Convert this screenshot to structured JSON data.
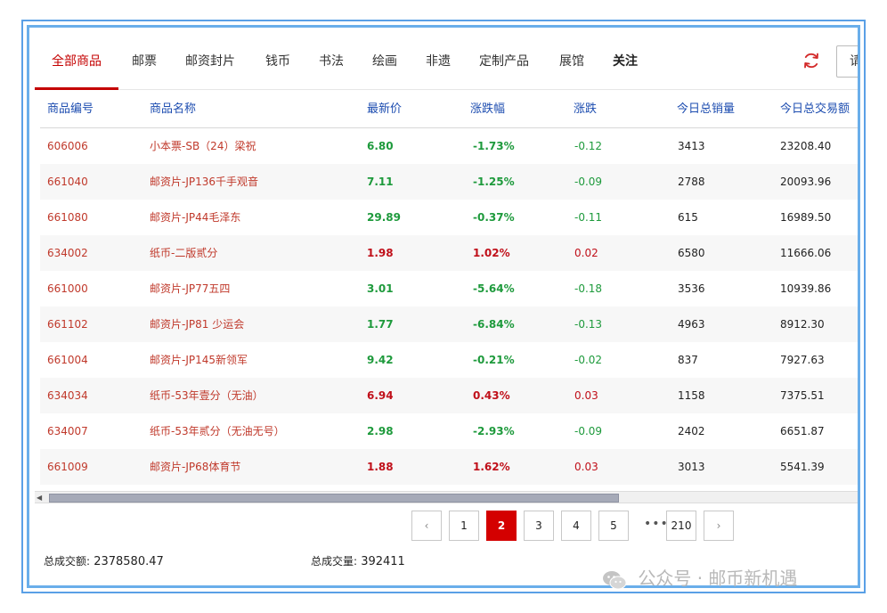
{
  "tabs": [
    {
      "label": "全部商品",
      "active": true
    },
    {
      "label": "邮票"
    },
    {
      "label": "邮资封片"
    },
    {
      "label": "钱币"
    },
    {
      "label": "书法"
    },
    {
      "label": "绘画"
    },
    {
      "label": "非遗"
    },
    {
      "label": "定制产品"
    },
    {
      "label": "展馆"
    },
    {
      "label": "关注"
    }
  ],
  "search": {
    "placeholder": "请"
  },
  "table": {
    "headers": [
      "商品编号",
      "商品名称",
      "最新价",
      "涨跌幅",
      "涨跌",
      "今日总销量",
      "今日总交易额"
    ],
    "rows": [
      {
        "code": "606006",
        "name": "小本票-SB（24）梁祝",
        "price": "6.80",
        "pct": "-1.73%",
        "chg": "-0.12",
        "vol": "3413",
        "amt": "23208.40",
        "trend": "down"
      },
      {
        "code": "661040",
        "name": "邮资片-JP136千手观音",
        "price": "7.11",
        "pct": "-1.25%",
        "chg": "-0.09",
        "vol": "2788",
        "amt": "20093.96",
        "trend": "down"
      },
      {
        "code": "661080",
        "name": "邮资片-JP44毛泽东",
        "price": "29.89",
        "pct": "-0.37%",
        "chg": "-0.11",
        "vol": "615",
        "amt": "16989.50",
        "trend": "down"
      },
      {
        "code": "634002",
        "name": "纸币-二版贰分",
        "price": "1.98",
        "pct": "1.02%",
        "chg": "0.02",
        "vol": "6580",
        "amt": "11666.06",
        "trend": "up"
      },
      {
        "code": "661000",
        "name": "邮资片-JP77五四",
        "price": "3.01",
        "pct": "-5.64%",
        "chg": "-0.18",
        "vol": "3536",
        "amt": "10939.86",
        "trend": "down"
      },
      {
        "code": "661102",
        "name": "邮资片-JP81 少运会",
        "price": "1.77",
        "pct": "-6.84%",
        "chg": "-0.13",
        "vol": "4963",
        "amt": "8912.30",
        "trend": "down"
      },
      {
        "code": "661004",
        "name": "邮资片-JP145新领军",
        "price": "9.42",
        "pct": "-0.21%",
        "chg": "-0.02",
        "vol": "837",
        "amt": "7927.63",
        "trend": "down"
      },
      {
        "code": "634034",
        "name": "纸币-53年壹分（无油）",
        "price": "6.94",
        "pct": "0.43%",
        "chg": "0.03",
        "vol": "1158",
        "amt": "7375.51",
        "trend": "up"
      },
      {
        "code": "634007",
        "name": "纸币-53年贰分（无油无号）",
        "price": "2.98",
        "pct": "-2.93%",
        "chg": "-0.09",
        "vol": "2402",
        "amt": "6651.87",
        "trend": "down"
      },
      {
        "code": "661009",
        "name": "邮资片-JP68体育节",
        "price": "1.88",
        "pct": "1.62%",
        "chg": "0.03",
        "vol": "3013",
        "amt": "5541.39",
        "trend": "up"
      }
    ]
  },
  "pagination": {
    "prev": "‹",
    "next": "›",
    "pages": [
      "1",
      "2",
      "3",
      "4",
      "5"
    ],
    "current": "2",
    "ellipsis": "•••",
    "last": "210"
  },
  "footer": {
    "total_amount_label": "总成交额:",
    "total_amount": "2378580.47",
    "total_volume_label": "总成交量:",
    "total_volume": "392411"
  },
  "watermark": {
    "text": "公众号 · 邮币新机遇"
  },
  "colors": {
    "accent": "#c40000",
    "up": "#c0101a",
    "down": "#1e9a3c",
    "header": "#1d4db0",
    "frame": "#5aa0e6"
  }
}
